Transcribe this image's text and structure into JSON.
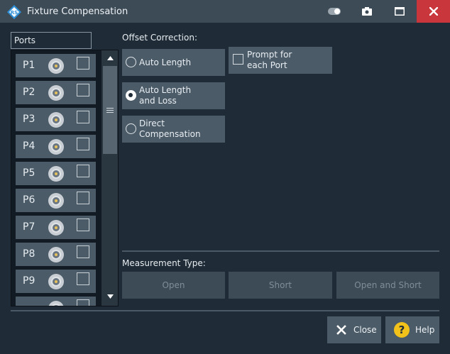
{
  "window": {
    "title": "Fixture Compensation"
  },
  "ports": {
    "header": "Ports",
    "items": [
      {
        "label": "P1",
        "checked": false
      },
      {
        "label": "P2",
        "checked": false
      },
      {
        "label": "P3",
        "checked": false
      },
      {
        "label": "P4",
        "checked": false
      },
      {
        "label": "P5",
        "checked": false
      },
      {
        "label": "P6",
        "checked": false
      },
      {
        "label": "P7",
        "checked": false
      },
      {
        "label": "P8",
        "checked": false
      },
      {
        "label": "P9",
        "checked": false
      }
    ]
  },
  "offset_correction": {
    "label": "Offset Correction:",
    "options": [
      {
        "label": "Auto Length",
        "selected": false
      },
      {
        "label": "Auto Length\nand Loss",
        "selected": true
      },
      {
        "label": "Direct\nCompensation",
        "selected": false
      }
    ],
    "prompt": {
      "label": "Prompt for\neach Port",
      "checked": false
    }
  },
  "measurement_type": {
    "label": "Measurement Type:",
    "buttons": [
      "Open",
      "Short",
      "Open and Short"
    ]
  },
  "footer": {
    "close_label": "Close",
    "help_label": "Help"
  },
  "colors": {
    "accent_close": "#c9373c",
    "help_yellow": "#f2c21b",
    "button_bg": "#4b5b68",
    "background": "#1f2b36"
  }
}
